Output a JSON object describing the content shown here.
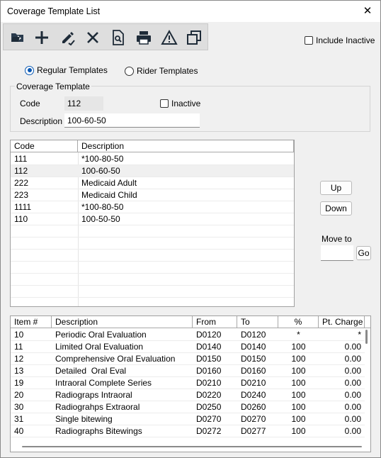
{
  "window": {
    "title": "Coverage Template List",
    "close_glyph": "✕"
  },
  "toolbar": {
    "buttons": [
      {
        "name": "open-folder-icon"
      },
      {
        "name": "add-icon"
      },
      {
        "name": "edit-icon"
      },
      {
        "name": "delete-icon"
      },
      {
        "name": "preview-icon"
      },
      {
        "name": "print-icon"
      },
      {
        "name": "warning-icon"
      },
      {
        "name": "copy-icon"
      }
    ]
  },
  "include_inactive": {
    "label": "Include Inactive",
    "checked": false
  },
  "template_type": {
    "regular_label": "Regular Templates",
    "rider_label": "Rider Templates",
    "selected": "regular"
  },
  "coverage_template": {
    "legend": "Coverage Template",
    "code_label": "Code",
    "code_value": "112",
    "inactive_label": "Inactive",
    "description_label": "Description",
    "description_value": "100-60-50"
  },
  "templates_grid": {
    "headers": [
      "Code",
      "Description"
    ],
    "rows": [
      [
        "111",
        "*100-80-50"
      ],
      [
        "112",
        "100-60-50"
      ],
      [
        "222",
        "Medicaid Adult"
      ],
      [
        "223",
        "Medicaid Child"
      ],
      [
        "1111",
        "*100-80-50"
      ],
      [
        "110",
        "100-50-50"
      ]
    ],
    "selected_index": 1
  },
  "side": {
    "up_label": "Up",
    "down_label": "Down",
    "move_to_label": "Move to",
    "move_to_value": "",
    "go_label": "Go"
  },
  "items_grid": {
    "headers": [
      "Item #",
      "Description",
      "From",
      "To",
      "%",
      "Pt. Charge"
    ],
    "rows": [
      [
        "10",
        "Periodic Oral Evaluation",
        "D0120",
        "D0120",
        "*",
        "*"
      ],
      [
        "11",
        "Limited Oral Evaluation",
        "D0140",
        "D0140",
        "100",
        "0.00"
      ],
      [
        "12",
        "Comprehensive Oral Evaluation",
        "D0150",
        "D0150",
        "100",
        "0.00"
      ],
      [
        "13",
        "Detailed  Oral Eval",
        "D0160",
        "D0160",
        "100",
        "0.00"
      ],
      [
        "19",
        "Intraoral Complete Series",
        "D0210",
        "D0210",
        "100",
        "0.00"
      ],
      [
        "20",
        "Radiograps Intraoral",
        "D0220",
        "D0240",
        "100",
        "0.00"
      ],
      [
        "30",
        "Radiograhps Extraoral",
        "D0250",
        "D0260",
        "100",
        "0.00"
      ],
      [
        "31",
        "Single bitewing",
        "D0270",
        "D0270",
        "100",
        "0.00"
      ],
      [
        "40",
        "Radiographs Bitewings",
        "D0272",
        "D0277",
        "100",
        "0.00"
      ]
    ]
  }
}
